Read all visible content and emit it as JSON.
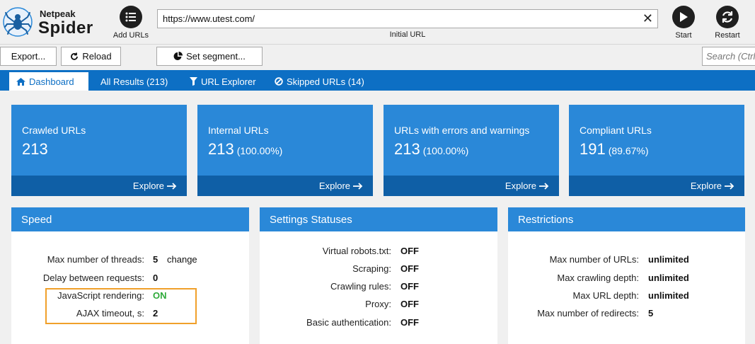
{
  "app": {
    "logo_small": "Netpeak",
    "logo_big": "Spider"
  },
  "toolbar": {
    "add_urls_label": "Add URLs",
    "url_value": "https://www.utest.com/",
    "url_caption": "Initial URL",
    "start_label": "Start",
    "restart_label": "Restart",
    "clear_glyph": "✕"
  },
  "actions": {
    "export_label": "Export...",
    "reload_label": "Reload",
    "segment_label": "Set segment...",
    "search_placeholder": "Search (Ctrl+F)"
  },
  "tabs": [
    {
      "label": "Dashboard",
      "icon": "home-icon",
      "active": true
    },
    {
      "label": "All Results (213)",
      "icon": "",
      "active": false
    },
    {
      "label": "URL Explorer",
      "icon": "filter-icon",
      "active": false
    },
    {
      "label": "Skipped URLs (14)",
      "icon": "blocked-icon",
      "active": false
    }
  ],
  "cards": [
    {
      "title": "Crawled URLs",
      "value": "213",
      "pct": "",
      "explore": "Explore"
    },
    {
      "title": "Internal URLs",
      "value": "213",
      "pct": "(100.00%)",
      "explore": "Explore"
    },
    {
      "title": "URLs with errors and warnings",
      "value": "213",
      "pct": "(100.00%)",
      "explore": "Explore"
    },
    {
      "title": "Compliant URLs",
      "value": "191",
      "pct": "(89.67%)",
      "explore": "Explore"
    }
  ],
  "speed": {
    "title": "Speed",
    "rows": [
      {
        "key": "Max number of threads:",
        "value": "5",
        "link": "change"
      },
      {
        "key": "Delay between requests:",
        "value": "0"
      },
      {
        "key": "JavaScript rendering:",
        "value": "ON"
      },
      {
        "key": "AJAX timeout, s:",
        "value": "2"
      }
    ]
  },
  "settings": {
    "title": "Settings Statuses",
    "rows": [
      {
        "key": "Virtual robots.txt:",
        "value": "OFF"
      },
      {
        "key": "Scraping:",
        "value": "OFF"
      },
      {
        "key": "Crawling rules:",
        "value": "OFF"
      },
      {
        "key": "Proxy:",
        "value": "OFF"
      },
      {
        "key": "Basic authentication:",
        "value": "OFF"
      }
    ]
  },
  "restrictions": {
    "title": "Restrictions",
    "rows": [
      {
        "key": "Max number of URLs:",
        "value": "unlimited"
      },
      {
        "key": "Max crawling depth:",
        "value": "unlimited"
      },
      {
        "key": "Max URL depth:",
        "value": "unlimited"
      },
      {
        "key": "Max number of redirects:",
        "value": "5"
      }
    ]
  },
  "colors": {
    "brand_blue": "#0d6fc4",
    "card_blue": "#2a88d8",
    "card_footer": "#0f5fa6",
    "on_green": "#2eaa3a",
    "highlight_orange": "#f0a02a"
  }
}
